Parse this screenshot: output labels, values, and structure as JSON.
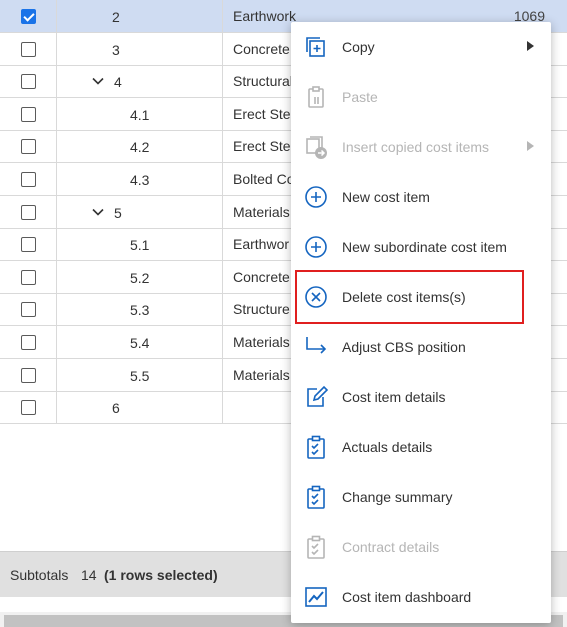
{
  "grid": {
    "rows": [
      {
        "checked": true,
        "number": "2",
        "indent": 0,
        "expander": false,
        "name": "Earthwork",
        "amount": "1069"
      },
      {
        "checked": false,
        "number": "3",
        "indent": 0,
        "expander": false,
        "name": "Concrete",
        "amount": ""
      },
      {
        "checked": false,
        "number": "4",
        "indent": 0,
        "expander": true,
        "name": "Structural",
        "amount": ""
      },
      {
        "checked": false,
        "number": "4.1",
        "indent": 1,
        "expander": false,
        "name": "Erect Ste",
        "amount": ""
      },
      {
        "checked": false,
        "number": "4.2",
        "indent": 1,
        "expander": false,
        "name": "Erect Ste",
        "amount": ""
      },
      {
        "checked": false,
        "number": "4.3",
        "indent": 1,
        "expander": false,
        "name": "Bolted Co",
        "amount": ""
      },
      {
        "checked": false,
        "number": "5",
        "indent": 0,
        "expander": true,
        "name": "Materials",
        "amount": ""
      },
      {
        "checked": false,
        "number": "5.1",
        "indent": 1,
        "expander": false,
        "name": "Earthwor",
        "amount": ""
      },
      {
        "checked": false,
        "number": "5.2",
        "indent": 1,
        "expander": false,
        "name": "Concrete",
        "amount": ""
      },
      {
        "checked": false,
        "number": "5.3",
        "indent": 1,
        "expander": false,
        "name": "Structure",
        "amount": ""
      },
      {
        "checked": false,
        "number": "5.4",
        "indent": 1,
        "expander": false,
        "name": "Materials",
        "amount": ""
      },
      {
        "checked": false,
        "number": "5.5",
        "indent": 1,
        "expander": false,
        "name": "Materials",
        "amount": ""
      },
      {
        "checked": false,
        "number": "6",
        "indent": 0,
        "expander": false,
        "name": "",
        "amount": ""
      }
    ]
  },
  "footer": {
    "subtotals_label": "Subtotals",
    "count": "14",
    "selection_text": "(1 rows selected)"
  },
  "context_menu": {
    "items": [
      {
        "label": "Copy",
        "icon": "copy-icon",
        "disabled": false,
        "submenu": true
      },
      {
        "label": "Paste",
        "icon": "paste-icon",
        "disabled": true,
        "submenu": false
      },
      {
        "label": "Insert copied cost items",
        "icon": "insert-copied-icon",
        "disabled": true,
        "submenu": true
      },
      {
        "label": "New cost item",
        "icon": "plus-circle-icon",
        "disabled": false,
        "submenu": false
      },
      {
        "label": "New subordinate cost item",
        "icon": "plus-circle-icon",
        "disabled": false,
        "submenu": false
      },
      {
        "label": "Delete cost items(s)",
        "icon": "x-circle-icon",
        "disabled": false,
        "submenu": false
      },
      {
        "label": "Adjust CBS position",
        "icon": "arrow-turn-right-icon",
        "disabled": false,
        "submenu": false
      },
      {
        "label": "Cost item details",
        "icon": "edit-icon",
        "disabled": false,
        "submenu": false
      },
      {
        "label": "Actuals details",
        "icon": "clipboard-check-icon",
        "disabled": false,
        "submenu": false
      },
      {
        "label": "Change summary",
        "icon": "clipboard-check-icon",
        "disabled": false,
        "submenu": false
      },
      {
        "label": "Contract details",
        "icon": "clipboard-check-icon",
        "disabled": true,
        "submenu": false
      },
      {
        "label": "Cost item dashboard",
        "icon": "line-chart-icon",
        "disabled": false,
        "submenu": false
      }
    ],
    "highlighted_item": "Delete cost items(s)"
  },
  "colors": {
    "accent": "#1a73e8",
    "icon_blue": "#1565c0",
    "disabled": "#b5b5b5",
    "selected_row": "#cfdcf2",
    "highlight_border": "#e01f1f"
  }
}
